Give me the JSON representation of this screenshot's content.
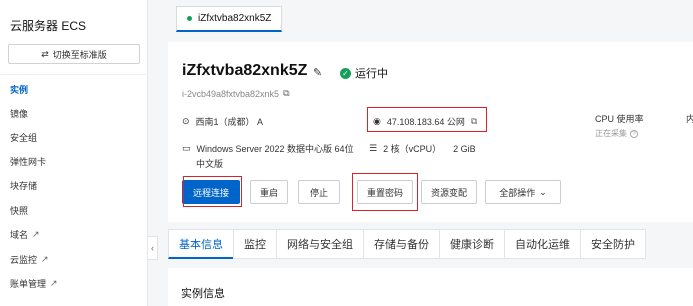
{
  "sidebar": {
    "title": "云服务器 ECS",
    "switch_label": "切换至标准版",
    "items": [
      {
        "label": "实例",
        "active": true,
        "external": false
      },
      {
        "label": "镜像",
        "external": false
      },
      {
        "label": "安全组",
        "external": false
      },
      {
        "label": "弹性网卡",
        "external": false
      },
      {
        "label": "块存储",
        "external": false
      },
      {
        "label": "快照",
        "external": false
      },
      {
        "label": "域名",
        "external": true
      },
      {
        "label": "云监控",
        "external": true
      },
      {
        "label": "账单管理",
        "external": true
      }
    ],
    "collapse_glyph": "‹"
  },
  "instance_tab": {
    "label": "iZfxtvba82xnk5Z"
  },
  "instance": {
    "name": "iZfxtvba82xnk5Z",
    "status": "运行中",
    "id": "i-2vcb49a8fxtvba82xnk5",
    "region": "西南1（成都） A",
    "ip": "47.108.183.64 公网",
    "os": "Windows Server 2022 数据中心版 64位",
    "os_sub": "中文版",
    "cpu": "2 核（vCPU）",
    "memory": "2 GiB",
    "cpu_usage_label": "CPU 使用率",
    "collecting": "正在采集",
    "edge_letter": "内"
  },
  "actions": {
    "remote": "远程连接",
    "restart": "重启",
    "stop": "停止",
    "reset_password": "重置密码",
    "resize": "资源变配",
    "all_ops": "全部操作"
  },
  "tabs": [
    "基本信息",
    "监控",
    "网络与安全组",
    "存储与备份",
    "健康诊断",
    "自动化运维",
    "安全防护"
  ],
  "section": {
    "title": "实例信息"
  },
  "colors": {
    "accent": "#0064c8",
    "running": "#14a05c",
    "highlight": "#d8232a"
  }
}
